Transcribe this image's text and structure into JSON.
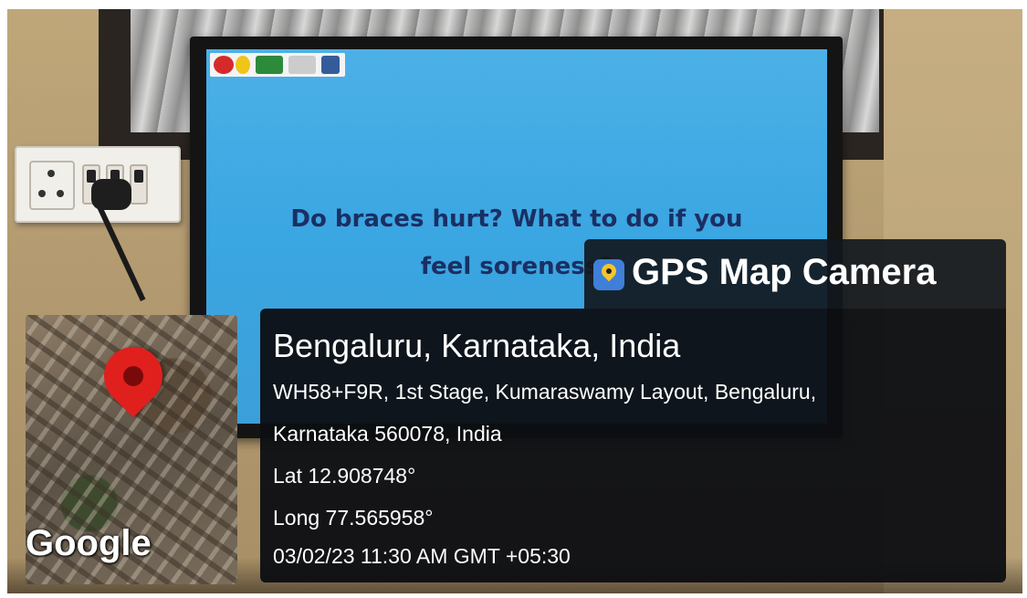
{
  "tv": {
    "screen_text_line1": "Do braces hurt? What to do if you",
    "screen_text_line2": "feel soreness?"
  },
  "gps_overlay": {
    "app_title": "GPS Map Camera",
    "city": "Bengaluru, Karnataka, India",
    "address_line1": "WH58+F9R, 1st Stage, Kumaraswamy Layout, Bengaluru,",
    "address_line2": "Karnataka 560078, India",
    "latitude": "Lat 12.908748°",
    "longitude": "Long 77.565958°",
    "datetime": "03/02/23 11:30 AM GMT +05:30"
  },
  "map": {
    "provider_label": "Google",
    "pin_color": "#e0201d"
  },
  "colors": {
    "screen_blue": "#3aa6e2",
    "screen_text": "#1b2f63",
    "overlay_bg": "#0c0e12"
  }
}
